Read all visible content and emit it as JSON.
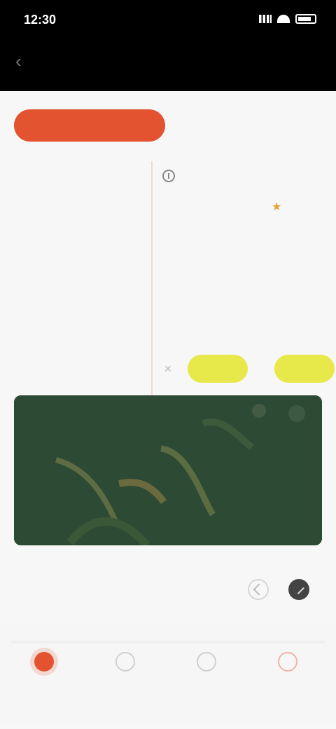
{
  "status": {
    "time": "12:30"
  },
  "appbar": {
    "title": "",
    "back": "‹"
  },
  "tabs": {
    "active": "",
    "other": ""
  },
  "left": {
    "head": "",
    "big": "",
    "big2": "",
    "foot": ""
  },
  "right": {
    "notice": "",
    "chip1": "",
    "chip2": "",
    "row1": "",
    "row2": "",
    "pill1": "",
    "pill2": ""
  },
  "section": {
    "title": ""
  },
  "bottom_nav": [
    {
      "label": ""
    },
    {
      "label": ""
    },
    {
      "label": ""
    },
    {
      "label": ""
    }
  ],
  "colors": {
    "accent": "#e4532f",
    "pill": "#e7e84a",
    "media_bg": "#2d4a34"
  }
}
